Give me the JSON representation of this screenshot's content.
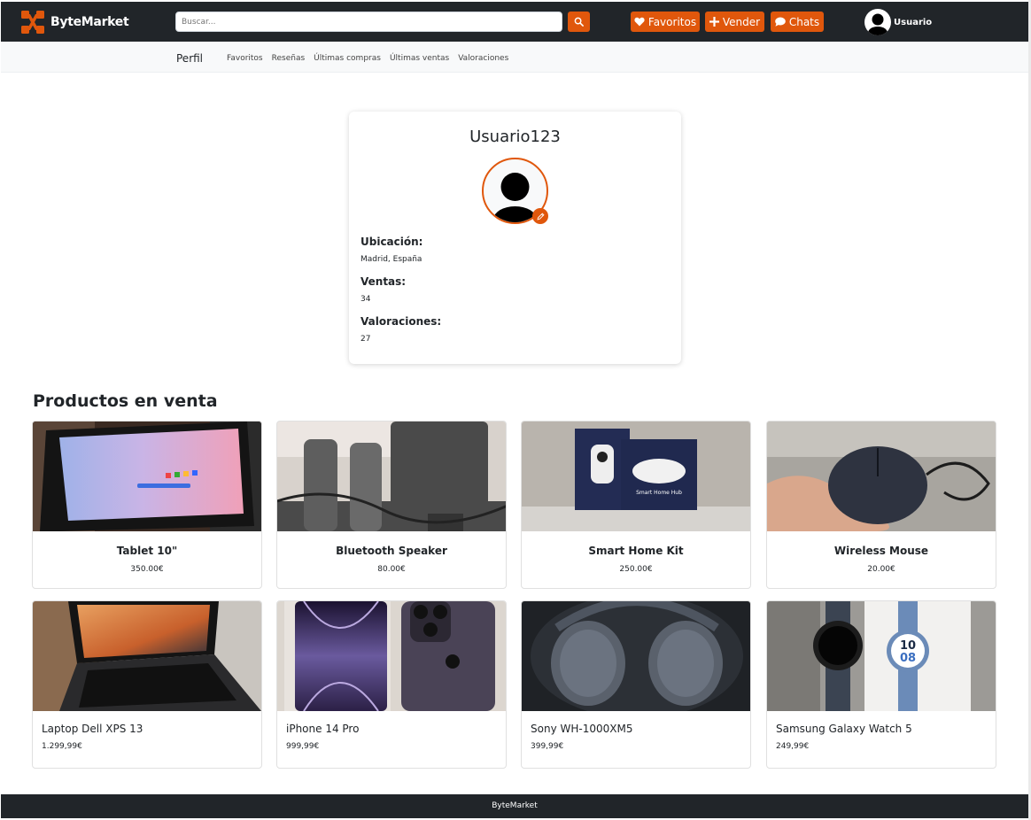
{
  "brand": {
    "name": "ByteMarket",
    "accent_color": "#e0570c",
    "dark_color": "#212529"
  },
  "header": {
    "search_placeholder": "Buscar...",
    "favorites_label": "Favoritos",
    "sell_label": "Vender",
    "chats_label": "Chats",
    "user_label": "Usuario"
  },
  "subnav": {
    "title": "Perfil",
    "links": [
      "Favoritos",
      "Reseñas",
      "Últimas compras",
      "Últimas ventas",
      "Valoraciones"
    ]
  },
  "profile": {
    "username": "Usuario123",
    "location_label": "Ubicación:",
    "location_value": "Madrid, España",
    "sales_label": "Ventas:",
    "sales_value": "34",
    "ratings_label": "Valoraciones:",
    "ratings_value": "27"
  },
  "products_section": {
    "title": "Productos en venta",
    "items": [
      {
        "name": "Tablet 10\"",
        "price": "350.00€"
      },
      {
        "name": "Bluetooth Speaker",
        "price": "80.00€"
      },
      {
        "name": "Smart Home Kit",
        "price": "250.00€"
      },
      {
        "name": "Wireless Mouse",
        "price": "20.00€"
      },
      {
        "name": "Laptop Dell XPS 13",
        "price": "1.299,99€"
      },
      {
        "name": "iPhone 14 Pro",
        "price": "999,99€"
      },
      {
        "name": "Sony WH-1000XM5",
        "price": "399,99€"
      },
      {
        "name": "Samsung Galaxy Watch 5",
        "price": "249,99€"
      }
    ]
  },
  "image_text": {
    "smart_hub": "Smart Home Hub",
    "watch_hour": "10",
    "watch_minute": "08"
  },
  "footer": {
    "text": "ByteMarket"
  }
}
